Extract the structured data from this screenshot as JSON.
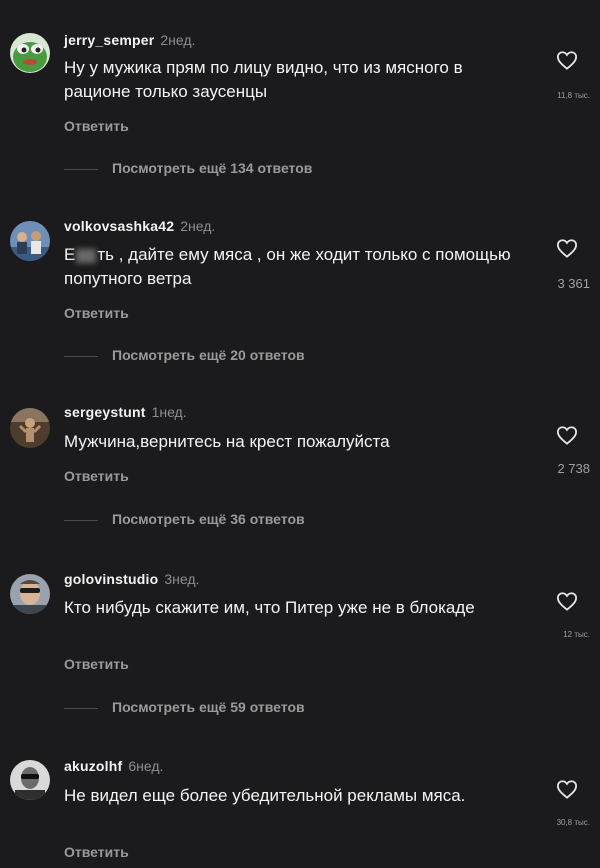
{
  "comments": [
    {
      "username": "jerry_semper",
      "time": "2нед.",
      "text": "Ну у мужика прям по лицу видно, что из мясного в рационе только заусенцы",
      "likes": "11,8 тыс.",
      "reply_label": "Ответить",
      "more_replies": "Посмотреть ещё 134 ответов",
      "avatar_color": "#3d8f3a"
    },
    {
      "username": "volkovsashka42",
      "time": "2нед.",
      "text_prefix": "Е",
      "text_suffix": "ть , дайте ему мяса , он же ходит только с помощью попутного ветра",
      "likes": "3 361",
      "reply_label": "Ответить",
      "more_replies": "Посмотреть ещё 20 ответов",
      "avatar_color": "#4a6e9a"
    },
    {
      "username": "sergeystunt",
      "time": "1нед.",
      "text": "Мужчина,вернитесь на крест пожалуйста",
      "likes": "2 738",
      "reply_label": "Ответить",
      "more_replies": "Посмотреть ещё 36 ответов",
      "avatar_color": "#5a4632"
    },
    {
      "username": "golovinstudio",
      "time": "3нед.",
      "text": "Кто нибудь скажите им, что Питер уже не в блокаде",
      "likes": "12 тыс.",
      "reply_label": "Ответить",
      "more_replies": "Посмотреть ещё 59 ответов",
      "avatar_color": "#7a7f86"
    },
    {
      "username": "akuzolhf",
      "time": "6нед.",
      "text": "Не видел еще более убедительной рекламы мяса.",
      "likes": "30,8 тыс.",
      "reply_label": "Ответить",
      "avatar_color": "#cfcfcf"
    }
  ]
}
